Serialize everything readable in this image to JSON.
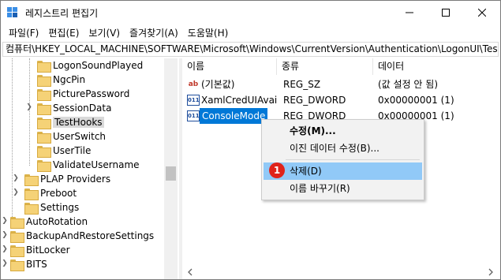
{
  "window": {
    "title": "레지스트리 편집기",
    "controls": {
      "minimize": "minimize-icon",
      "maximize": "maximize-icon",
      "close": "close-icon"
    }
  },
  "menu": [
    "파일(F)",
    "편집(E)",
    "보기(V)",
    "즐겨찾기(A)",
    "도움말(H)"
  ],
  "address": "컴퓨터\\HKEY_LOCAL_MACHINE\\SOFTWARE\\Microsoft\\Windows\\CurrentVersion\\Authentication\\LogonUI\\TestHooks",
  "tree": {
    "items": [
      {
        "label": "LogonSoundPlayed"
      },
      {
        "label": "NgcPin"
      },
      {
        "label": "PicturePassword"
      },
      {
        "label": "SessionData"
      },
      {
        "label": "TestHooks",
        "selected": true
      },
      {
        "label": "UserSwitch"
      },
      {
        "label": "UserTile"
      },
      {
        "label": "ValidateUsername"
      },
      {
        "label": "PLAP Providers"
      },
      {
        "label": "Preboot"
      },
      {
        "label": "Settings"
      },
      {
        "label": "AutoRotation"
      },
      {
        "label": "BackupAndRestoreSettings"
      },
      {
        "label": "BitLocker"
      },
      {
        "label": "BITS"
      }
    ]
  },
  "list": {
    "columns": [
      "이름",
      "종류",
      "데이터"
    ],
    "rows": [
      {
        "name": "(기본값)",
        "type": "REG_SZ",
        "data": "(값 설정 안 됨)",
        "icon": "ab"
      },
      {
        "name": "XamlCredUIAvai...",
        "type": "REG_DWORD",
        "data": "0x00000001 (1)",
        "icon": "011"
      },
      {
        "name": "ConsoleMode",
        "type": "REG_DWORD",
        "data": "0x00000001 (1)",
        "icon": "011",
        "selected": true
      }
    ]
  },
  "context_menu": {
    "items": [
      "수정(M)...",
      "이진 데이터 수정(B)...",
      "삭제(D)",
      "이름 바꾸기(R)"
    ],
    "highlighted": "삭제(D)",
    "step_badge": "1"
  },
  "colors": {
    "selection": "#0078d7",
    "menu_highlight": "#91c9f7",
    "badge": "#e0231b"
  }
}
